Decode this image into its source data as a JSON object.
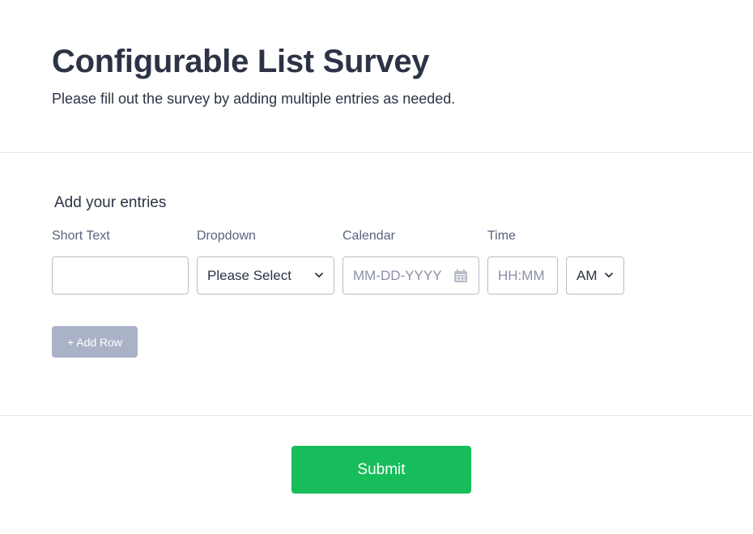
{
  "header": {
    "title": "Configurable List Survey",
    "subtitle": "Please fill out the survey by adding multiple entries as needed."
  },
  "list": {
    "label": "Add your entries",
    "columns": [
      {
        "label": "Short Text",
        "value": "",
        "icon": ""
      },
      {
        "label": "Dropdown",
        "value": "Please Select",
        "icon": "chevron-down-icon"
      },
      {
        "label": "Calendar",
        "placeholder": "MM-DD-YYYY",
        "icon": "calendar-icon"
      },
      {
        "label": "Time",
        "placeholder": "HH:MM",
        "ampm_value": "AM",
        "icon": "chevron-down-icon"
      }
    ],
    "add_row_label": "+ Add Row"
  },
  "submit_label": "Submit",
  "colors": {
    "text": "#2c3345",
    "muted_label": "#57647e",
    "placeholder": "#8d8fa8",
    "border": "#b8bdc9",
    "add_row_bg": "#aab2c8",
    "submit_bg": "#18bd5b",
    "divider": "#e3e5ea"
  }
}
